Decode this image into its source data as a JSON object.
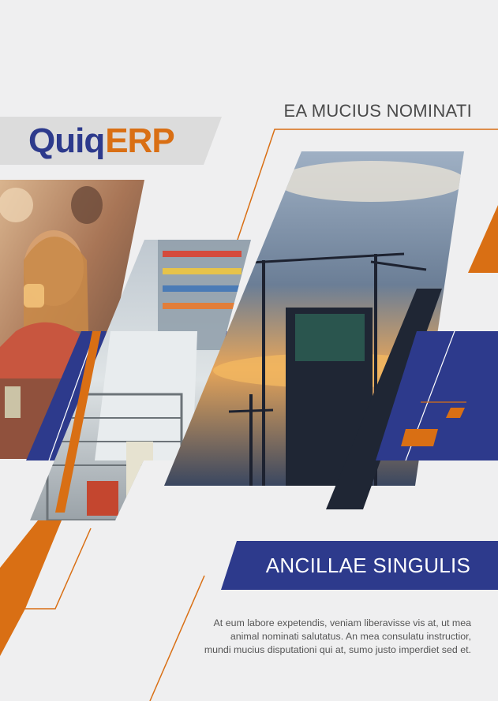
{
  "brand": {
    "logo_quiq": "Quiq",
    "logo_erp": "ERP",
    "accent_orange": "#d96f14",
    "accent_navy": "#2d3a8c"
  },
  "header": {
    "heading": "EA MUCIUS NOMINATI"
  },
  "banner": {
    "title": "ANCILLAE SINGULIS"
  },
  "body": {
    "paragraph": "At eum labore expetendis, veniam liberavisse vis at, ut mea animal nominati salutatus. An mea consulatu instructior, mundi mucius disputationi qui at, sumo justo imperdiet sed et."
  },
  "images": [
    {
      "name": "woman-drinking-photo"
    },
    {
      "name": "supermarket-aisle-photo"
    },
    {
      "name": "construction-crane-photo"
    }
  ]
}
